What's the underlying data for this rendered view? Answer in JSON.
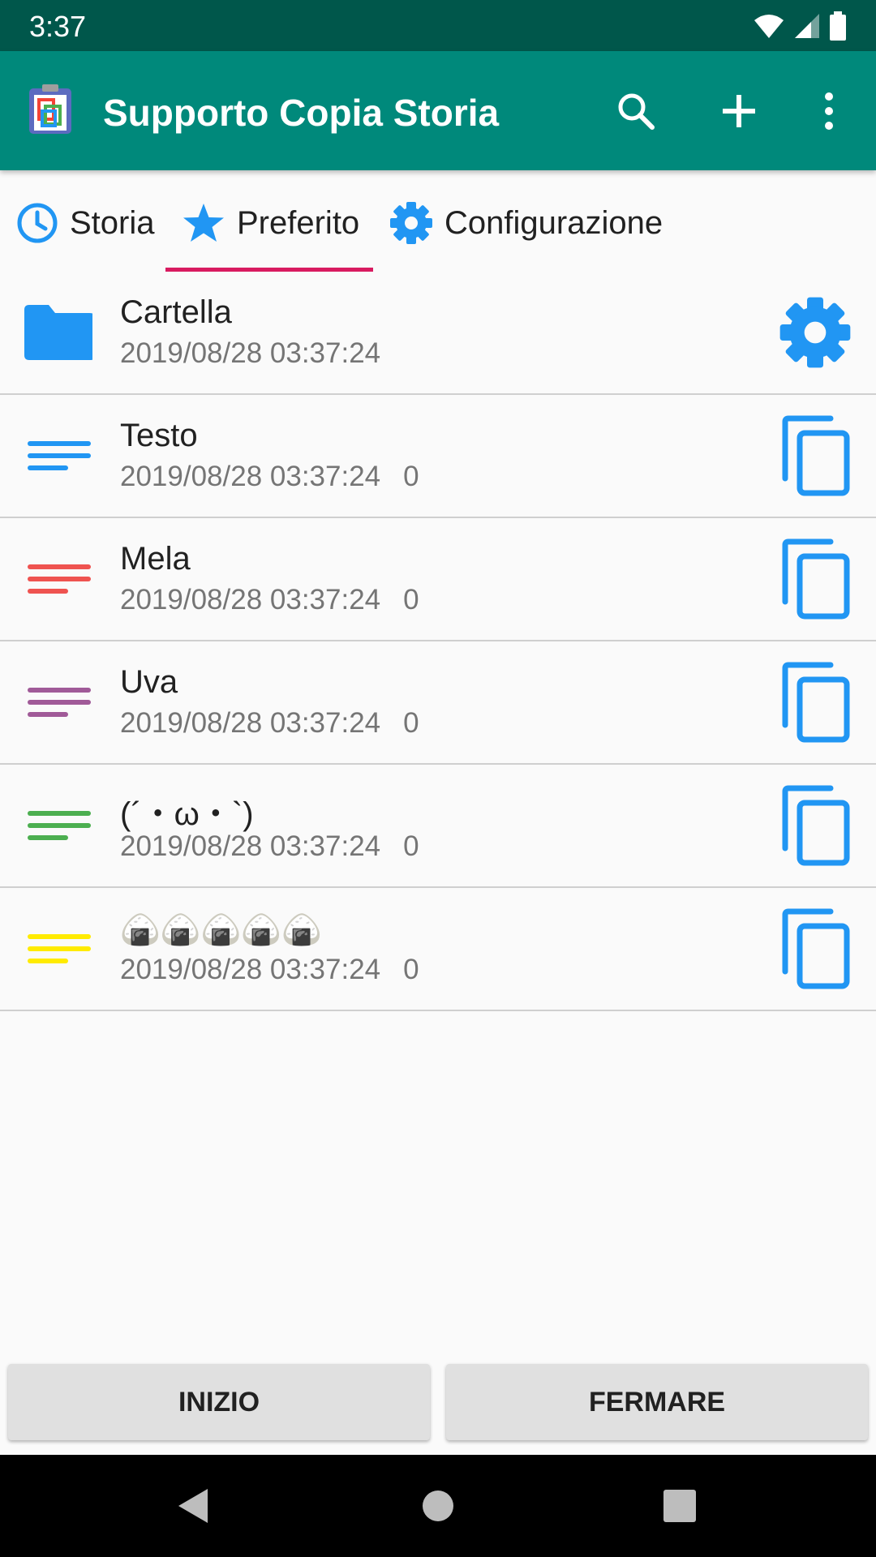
{
  "status_bar": {
    "time": "3:37"
  },
  "app_bar": {
    "title": "Supporto Copia Storia",
    "actions": [
      "search-icon",
      "add-icon",
      "more-vert-icon"
    ]
  },
  "tabs": [
    {
      "label": "Storia",
      "icon": "clock-icon",
      "selected": false
    },
    {
      "label": "Preferito",
      "icon": "star-icon",
      "selected": true
    },
    {
      "label": "Configurazione",
      "icon": "gear-icon",
      "selected": false
    }
  ],
  "items": [
    {
      "type": "folder",
      "name": "Cartella",
      "date": "2019/08/28 03:37:24",
      "color": "#2196f3",
      "action_icon": "gear-icon"
    },
    {
      "type": "text",
      "name": "Testo",
      "date": "2019/08/28 03:37:24",
      "count": "0",
      "color": "#2196f3",
      "action_icon": "copy-icon"
    },
    {
      "type": "text",
      "name": "Mela",
      "date": "2019/08/28 03:37:24",
      "count": "0",
      "color": "#ef5350",
      "action_icon": "copy-icon"
    },
    {
      "type": "text",
      "name": "Uva",
      "date": "2019/08/28 03:37:24",
      "count": "0",
      "color": "#a05a98",
      "action_icon": "copy-icon"
    },
    {
      "type": "text",
      "name": "(´・ω・`)",
      "date": "2019/08/28 03:37:24",
      "count": "0",
      "color": "#4caf50",
      "action_icon": "copy-icon"
    },
    {
      "type": "text",
      "name": "🍙🍙🍙🍙🍙",
      "date": "2019/08/28 03:37:24",
      "count": "0",
      "color": "#ffeb00",
      "action_icon": "copy-icon"
    }
  ],
  "buttons": {
    "start": "INIZIO",
    "stop": "FERMARE"
  },
  "colors": {
    "primary": "#00897b",
    "primary_dark": "#00574b",
    "accent": "#d81b60",
    "icon_blue": "#2196f3"
  }
}
